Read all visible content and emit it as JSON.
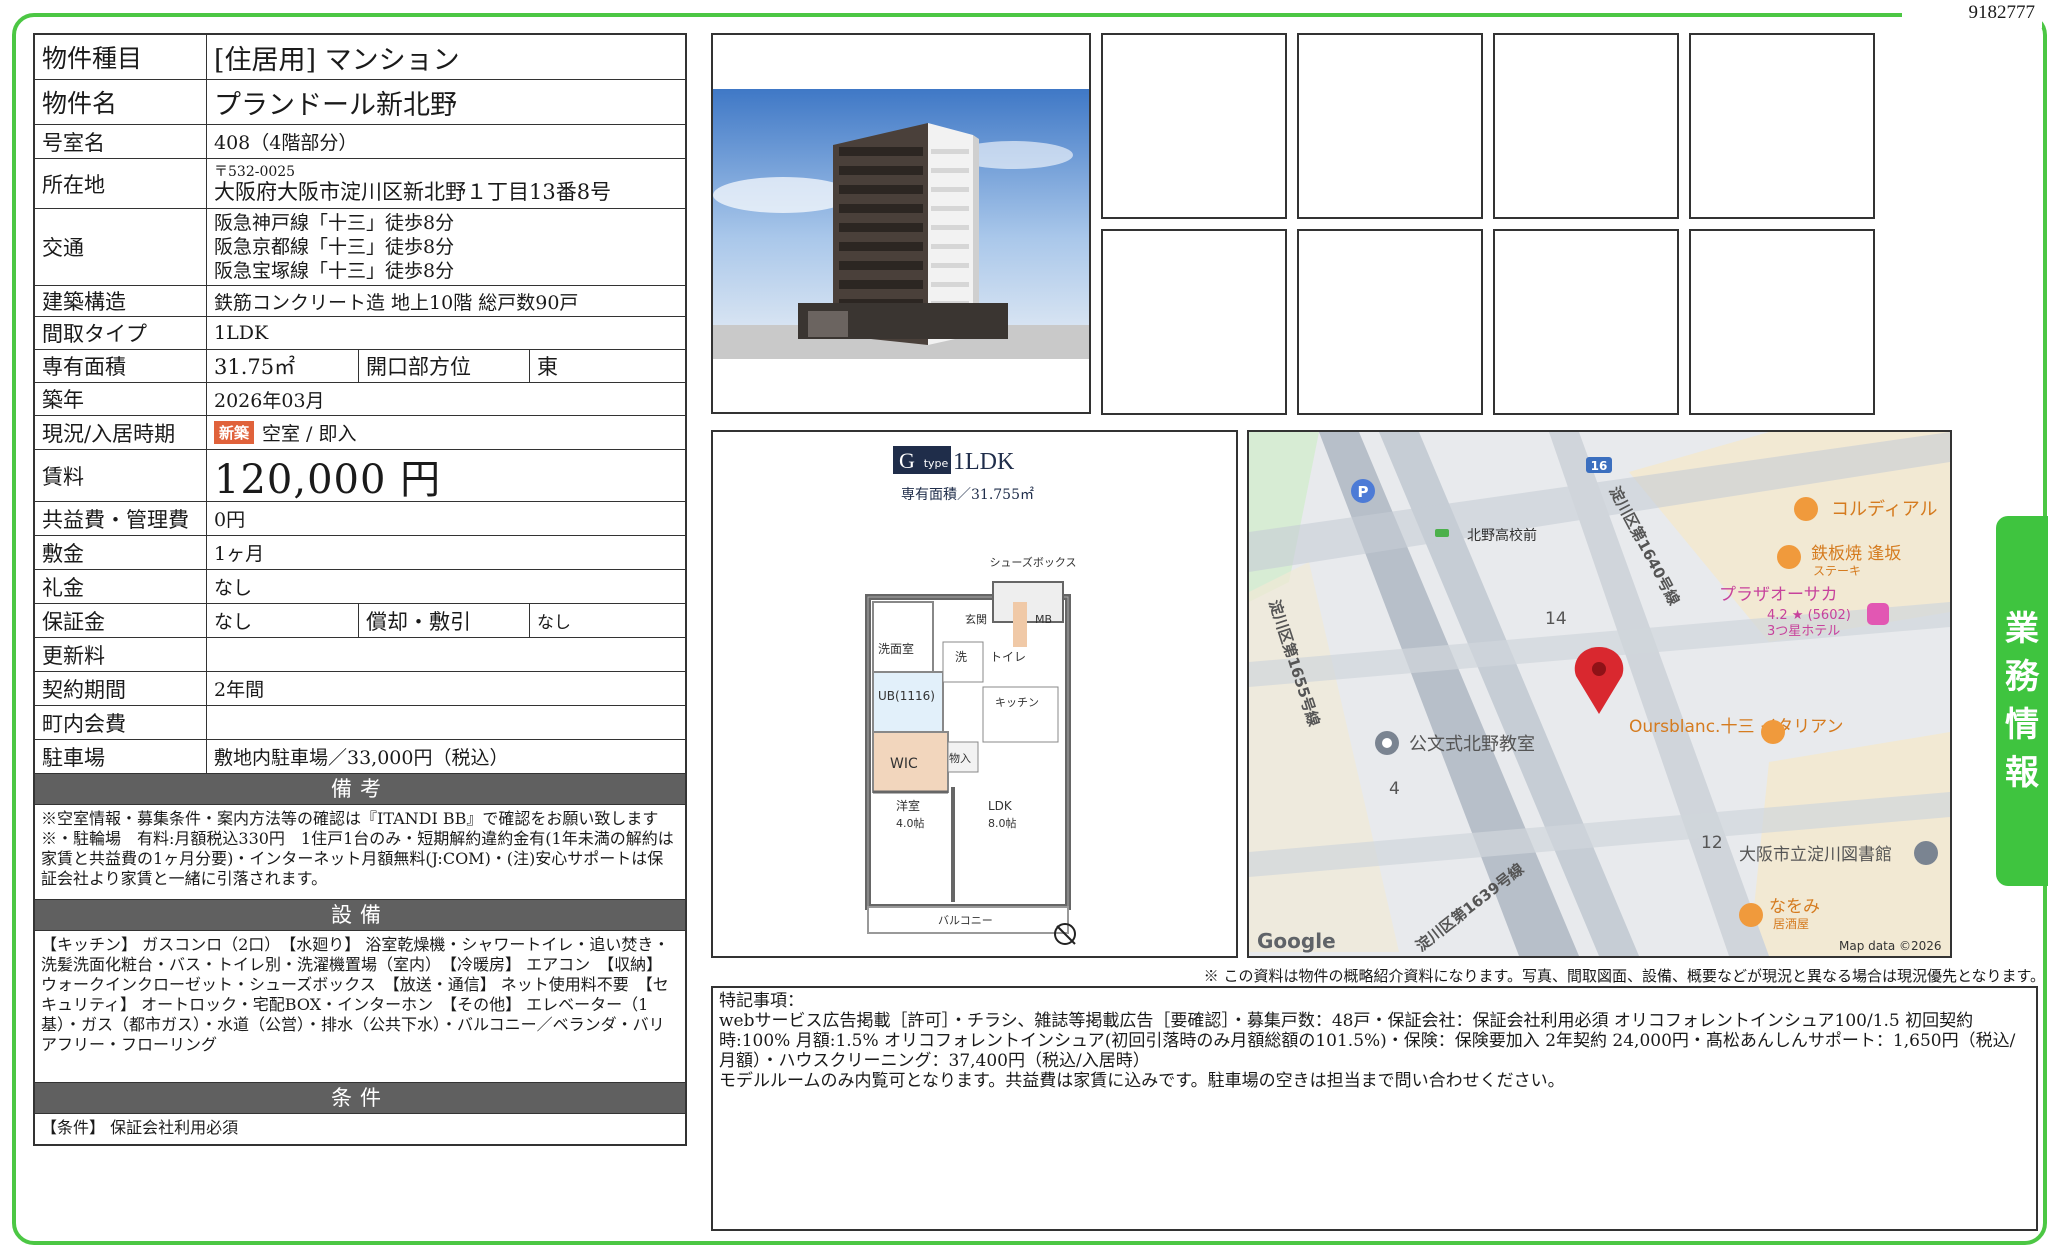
{
  "doc_id": "9182777",
  "side_tab": "業務情報",
  "property": {
    "type": {
      "label": "物件種目",
      "value": "[住居用]  マンション"
    },
    "name": {
      "label": "物件名",
      "value": "プランドール新北野"
    },
    "room": {
      "label": "号室名",
      "value": "408（4階部分）"
    },
    "address": {
      "label": "所在地",
      "postal": "〒532-0025",
      "value": "大阪府大阪市淀川区新北野１丁目13番8号"
    },
    "transit": {
      "label": "交通",
      "lines": [
        "阪急神戸線「十三」徒歩8分",
        "阪急京都線「十三」徒歩8分",
        "阪急宝塚線「十三」徒歩8分"
      ]
    },
    "structure": {
      "label": "建築構造",
      "value": "鉄筋コンクリート造 地上10階 総戸数90戸"
    },
    "layout": {
      "label": "間取タイプ",
      "value": "1LDK"
    },
    "area": {
      "label": "専有面積",
      "value": "31.75㎡",
      "orient_label": "開口部方位",
      "orient_value": "東"
    },
    "built": {
      "label": "築年",
      "value": "2026年03月"
    },
    "status": {
      "label": "現況/入居時期",
      "badge": "新築",
      "value": "空室 / 即入"
    },
    "rent": {
      "label": "賃料",
      "value": "120,000 円"
    },
    "fee": {
      "label": "共益費・管理費",
      "value": "0円"
    },
    "deposit": {
      "label": "敷金",
      "value": "1ヶ月"
    },
    "key_money": {
      "label": "礼金",
      "value": "なし"
    },
    "guarantee": {
      "label": "保証金",
      "value": "なし",
      "amort_label": "償却・敷引",
      "amort_value": "なし"
    },
    "renewal": {
      "label": "更新料",
      "value": ""
    },
    "contract": {
      "label": "契約期間",
      "value": "2年間"
    },
    "town_fee": {
      "label": "町内会費",
      "value": ""
    },
    "parking": {
      "label": "駐車場",
      "value": "敷地内駐車場／33,000円（税込）"
    }
  },
  "remarks": {
    "title": "備考",
    "text": "※空室情報・募集条件・案内方法等の確認は『ITANDI BB』で確認をお願い致します※・駐輪場　有料:月額税込330円　1住戸1台のみ・短期解約違約金有(1年未満の解約は家賃と共益費の1ヶ月分要)・インターネット月額無料(J:COM)・(注)安心サポートは保証会社より家賃と一緒に引落されます。"
  },
  "equipment": {
    "title": "設備",
    "text": "【キッチン】 ガスコンロ（2口）　【水廻り】 浴室乾燥機・シャワートイレ・追い焚き・洗髪洗面化粧台・バス・トイレ別・洗濯機置場（室内）　【冷暖房】 エアコン　【収納】 ウォークインクローゼット・シューズボックス　【放送・通信】 ネット使用料不要　【セキュリティ】 オートロック・宅配BOX・インターホン　【その他】 エレベーター（1基）・ガス（都市ガス）・水道（公営）・排水（公共下水）・バルコニー／ベランダ・バリアフリー・フローリング"
  },
  "conditions": {
    "title": "条件",
    "text": "【条件】 保証会社利用必須"
  },
  "floorplan": {
    "type_letter": "G",
    "type_sub": "type",
    "type_name": "1LDK",
    "area_text": "専有面積／31.755㎡",
    "rooms": {
      "shoes": "シューズボックス",
      "entrance": "玄関",
      "mb": "MB",
      "washroom": "洗面室",
      "wash": "洗",
      "toilet": "トイレ",
      "ub": "UB(1116)",
      "kitchen": "キッチン",
      "wic": "WIC",
      "storage": "物入",
      "western": "洋室",
      "western_size": "4.0帖",
      "ldk": "LDK",
      "ldk_size": "8.0帖",
      "balcony": "バルコニー"
    }
  },
  "map": {
    "labels": {
      "route16": "16",
      "parking": "P",
      "bus_stop": "北野高校前",
      "road1": "淀川区第1640号線",
      "road2": "淀川区第1655号線",
      "road3": "淀川区第1639号線",
      "restaurant1": "コルディアル",
      "restaurant2": "鉄板焼 逢坂",
      "restaurant2_sub": "ステーキ",
      "hotel": "プラザオーサカ",
      "hotel_rating": "4.2 ★ (5602)",
      "hotel_sub": "3つ星ホテル",
      "block14": "14",
      "block4": "4",
      "block12": "12",
      "school": "公文式北野教室",
      "cafe": "Oursblanc.十三 イタリアン",
      "library": "大阪市立淀川図書館",
      "izakaya": "なをみ",
      "izakaya_sub": "居酒屋",
      "google": "Google",
      "map_data": "Map data ©2026"
    }
  },
  "disclaimer": "※ この資料は物件の概略紹介資料になります。写真、間取図面、設備、概要などが現況と異なる場合は現況優先となります。",
  "notes": {
    "heading": "特記事項：",
    "line1": "webサービス広告掲載［許可］・チラシ、雑誌等掲載広告［要確認］・募集戸数：48戸・保証会社：保証会社利用必須 オリコフォレントインシュア100/1.5 初回契約時:100% 月額:1.5% オリコフォレントインシュア(初回引落時のみ月額総額の101.5%)・保険：保険要加入 2年契約 24,000円・髙松あんしんサポート：1,650円（税込/月額）・ハウスクリーニング：37,400円（税込/入居時）",
    "line2": "モデルルームのみ内覧可となります。共益費は家賃に込みです。駐車場の空きは担当まで問い合わせください。"
  },
  "colors": {
    "frame": "#4cc744",
    "tab": "#3fc43f",
    "section_header": "#606060",
    "badge": "#e0623b",
    "map_pin": "#d9282f"
  }
}
